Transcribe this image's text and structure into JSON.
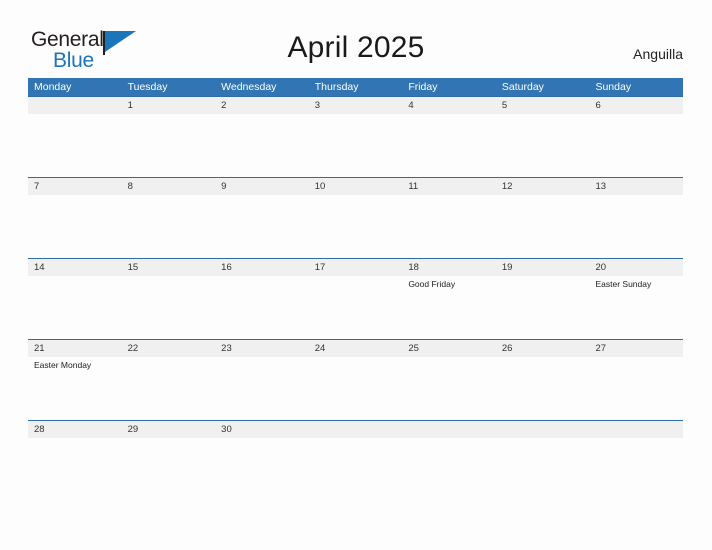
{
  "brand": {
    "name_part1": "General",
    "name_part2": "Blue",
    "flag_icon": "blue-flag-triangle",
    "accent_color": "#1b75bb"
  },
  "header": {
    "title": "April 2025",
    "region": "Anguilla"
  },
  "theme": {
    "header_blue": "#3175b4",
    "rule_blue": "#2e6da4",
    "band_gray": "#f0f0f0",
    "page_background": "#fdfdfd"
  },
  "calendar": {
    "month": "April",
    "year": "2025",
    "weekday_headers": [
      "Monday",
      "Tuesday",
      "Wednesday",
      "Thursday",
      "Friday",
      "Saturday",
      "Sunday"
    ],
    "weeks": [
      [
        {
          "date": "",
          "event": ""
        },
        {
          "date": "1",
          "event": ""
        },
        {
          "date": "2",
          "event": ""
        },
        {
          "date": "3",
          "event": ""
        },
        {
          "date": "4",
          "event": ""
        },
        {
          "date": "5",
          "event": ""
        },
        {
          "date": "6",
          "event": ""
        }
      ],
      [
        {
          "date": "7",
          "event": ""
        },
        {
          "date": "8",
          "event": ""
        },
        {
          "date": "9",
          "event": ""
        },
        {
          "date": "10",
          "event": ""
        },
        {
          "date": "11",
          "event": ""
        },
        {
          "date": "12",
          "event": ""
        },
        {
          "date": "13",
          "event": ""
        }
      ],
      [
        {
          "date": "14",
          "event": ""
        },
        {
          "date": "15",
          "event": ""
        },
        {
          "date": "16",
          "event": ""
        },
        {
          "date": "17",
          "event": ""
        },
        {
          "date": "18",
          "event": "Good Friday"
        },
        {
          "date": "19",
          "event": ""
        },
        {
          "date": "20",
          "event": "Easter Sunday"
        }
      ],
      [
        {
          "date": "21",
          "event": "Easter Monday"
        },
        {
          "date": "22",
          "event": ""
        },
        {
          "date": "23",
          "event": ""
        },
        {
          "date": "24",
          "event": ""
        },
        {
          "date": "25",
          "event": ""
        },
        {
          "date": "26",
          "event": ""
        },
        {
          "date": "27",
          "event": ""
        }
      ],
      [
        {
          "date": "28",
          "event": ""
        },
        {
          "date": "29",
          "event": ""
        },
        {
          "date": "30",
          "event": ""
        },
        {
          "date": "",
          "event": ""
        },
        {
          "date": "",
          "event": ""
        },
        {
          "date": "",
          "event": ""
        },
        {
          "date": "",
          "event": ""
        }
      ]
    ]
  }
}
